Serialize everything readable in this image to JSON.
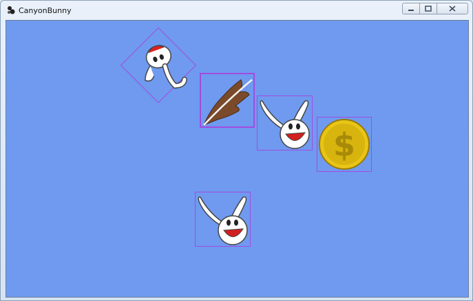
{
  "window": {
    "title": "CanyonBunny",
    "controls": [
      "minimize",
      "maximize",
      "close"
    ]
  },
  "scene": {
    "background_color": "#6f9aef",
    "debug_box_color": "#a24be0",
    "objects": [
      {
        "name": "bunny-falling",
        "icon": "bunny-falling-sprite"
      },
      {
        "name": "feather",
        "icon": "feather-sprite"
      },
      {
        "name": "bunny-head-1",
        "icon": "bunny-head-sprite"
      },
      {
        "name": "gold-coin",
        "icon": "gold-coin-sprite"
      },
      {
        "name": "bunny-head-2",
        "icon": "bunny-head-sprite"
      }
    ]
  }
}
